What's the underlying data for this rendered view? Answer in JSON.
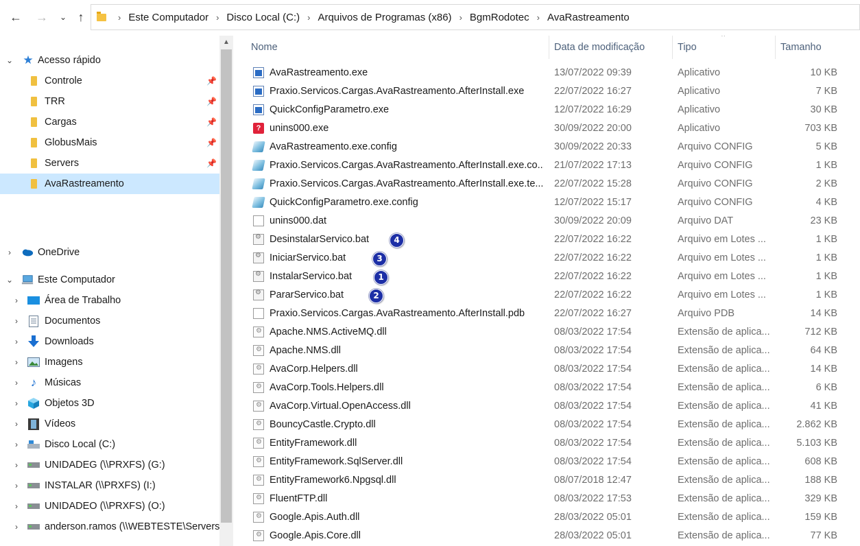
{
  "address": {
    "crumbs": [
      "Este Computador",
      "Disco Local (C:)",
      "Arquivos de Programas (x86)",
      "BgmRodotec",
      "AvaRastreamento"
    ]
  },
  "nav": {
    "quick_access": "Acesso rápido",
    "pinned": [
      "Controle",
      "TRR",
      "Cargas",
      "GlobusMais",
      "Servers"
    ],
    "selected": "AvaRastreamento",
    "onedrive": "OneDrive",
    "this_pc": "Este Computador",
    "pc_items": [
      "Área de Trabalho",
      "Documentos",
      "Downloads",
      "Imagens",
      "Músicas",
      "Objetos 3D",
      "Vídeos",
      "Disco Local (C:)",
      "UNIDADEG (\\\\PRXFS) (G:)",
      "INSTALAR (\\\\PRXFS) (I:)",
      "UNIDADEO (\\\\PRXFS) (O:)",
      "anderson.ramos (\\\\WEBTESTE\\Servers)"
    ]
  },
  "columns": {
    "name": "Nome",
    "date": "Data de modificação",
    "type": "Tipo",
    "size": "Tamanho"
  },
  "files": [
    {
      "name": "AvaRastreamento.exe",
      "date": "13/07/2022 09:39",
      "type": "Aplicativo",
      "size": "10 KB",
      "icon": "exe"
    },
    {
      "name": "Praxio.Servicos.Cargas.AvaRastreamento.AfterInstall.exe",
      "date": "22/07/2022 16:27",
      "type": "Aplicativo",
      "size": "7 KB",
      "icon": "exe"
    },
    {
      "name": "QuickConfigParametro.exe",
      "date": "12/07/2022 16:29",
      "type": "Aplicativo",
      "size": "30 KB",
      "icon": "exe"
    },
    {
      "name": "unins000.exe",
      "date": "30/09/2022 20:00",
      "type": "Aplicativo",
      "size": "703 KB",
      "icon": "unins"
    },
    {
      "name": "AvaRastreamento.exe.config",
      "date": "30/09/2022 20:33",
      "type": "Arquivo CONFIG",
      "size": "5 KB",
      "icon": "config"
    },
    {
      "name": "Praxio.Servicos.Cargas.AvaRastreamento.AfterInstall.exe.co...",
      "date": "21/07/2022 17:13",
      "type": "Arquivo CONFIG",
      "size": "1 KB",
      "icon": "config"
    },
    {
      "name": "Praxio.Servicos.Cargas.AvaRastreamento.AfterInstall.exe.te...",
      "date": "22/07/2022 15:28",
      "type": "Arquivo CONFIG",
      "size": "2 KB",
      "icon": "config"
    },
    {
      "name": "QuickConfigParametro.exe.config",
      "date": "12/07/2022 15:17",
      "type": "Arquivo CONFIG",
      "size": "4 KB",
      "icon": "config"
    },
    {
      "name": "unins000.dat",
      "date": "30/09/2022 20:09",
      "type": "Arquivo DAT",
      "size": "23 KB",
      "icon": "file"
    },
    {
      "name": "DesinstalarServico.bat",
      "date": "22/07/2022 16:22",
      "type": "Arquivo em Lotes ...",
      "size": "1 KB",
      "icon": "bat",
      "badge": "4"
    },
    {
      "name": "IniciarServico.bat",
      "date": "22/07/2022 16:22",
      "type": "Arquivo em Lotes ...",
      "size": "1 KB",
      "icon": "bat",
      "badge": "3"
    },
    {
      "name": "InstalarServico.bat",
      "date": "22/07/2022 16:22",
      "type": "Arquivo em Lotes ...",
      "size": "1 KB",
      "icon": "bat",
      "badge": "1"
    },
    {
      "name": "PararServico.bat",
      "date": "22/07/2022 16:22",
      "type": "Arquivo em Lotes ...",
      "size": "1 KB",
      "icon": "bat",
      "badge": "2"
    },
    {
      "name": "Praxio.Servicos.Cargas.AvaRastreamento.AfterInstall.pdb",
      "date": "22/07/2022 16:27",
      "type": "Arquivo PDB",
      "size": "14 KB",
      "icon": "file"
    },
    {
      "name": "Apache.NMS.ActiveMQ.dll",
      "date": "08/03/2022 17:54",
      "type": "Extensão de aplica...",
      "size": "712 KB",
      "icon": "dll"
    },
    {
      "name": "Apache.NMS.dll",
      "date": "08/03/2022 17:54",
      "type": "Extensão de aplica...",
      "size": "64 KB",
      "icon": "dll"
    },
    {
      "name": "AvaCorp.Helpers.dll",
      "date": "08/03/2022 17:54",
      "type": "Extensão de aplica...",
      "size": "14 KB",
      "icon": "dll"
    },
    {
      "name": "AvaCorp.Tools.Helpers.dll",
      "date": "08/03/2022 17:54",
      "type": "Extensão de aplica...",
      "size": "6 KB",
      "icon": "dll"
    },
    {
      "name": "AvaCorp.Virtual.OpenAccess.dll",
      "date": "08/03/2022 17:54",
      "type": "Extensão de aplica...",
      "size": "41 KB",
      "icon": "dll"
    },
    {
      "name": "BouncyCastle.Crypto.dll",
      "date": "08/03/2022 17:54",
      "type": "Extensão de aplica...",
      "size": "2.862 KB",
      "icon": "dll"
    },
    {
      "name": "EntityFramework.dll",
      "date": "08/03/2022 17:54",
      "type": "Extensão de aplica...",
      "size": "5.103 KB",
      "icon": "dll"
    },
    {
      "name": "EntityFramework.SqlServer.dll",
      "date": "08/03/2022 17:54",
      "type": "Extensão de aplica...",
      "size": "608 KB",
      "icon": "dll"
    },
    {
      "name": "EntityFramework6.Npgsql.dll",
      "date": "08/07/2018 12:47",
      "type": "Extensão de aplica...",
      "size": "188 KB",
      "icon": "dll"
    },
    {
      "name": "FluentFTP.dll",
      "date": "08/03/2022 17:53",
      "type": "Extensão de aplica...",
      "size": "329 KB",
      "icon": "dll"
    },
    {
      "name": "Google.Apis.Auth.dll",
      "date": "28/03/2022 05:01",
      "type": "Extensão de aplica...",
      "size": "159 KB",
      "icon": "dll"
    },
    {
      "name": "Google.Apis.Core.dll",
      "date": "28/03/2022 05:01",
      "type": "Extensão de aplica...",
      "size": "77 KB",
      "icon": "dll"
    }
  ],
  "colors": {
    "selection": "#cce8ff",
    "header_text": "#4c607a",
    "badge": "#1d2fa6"
  }
}
